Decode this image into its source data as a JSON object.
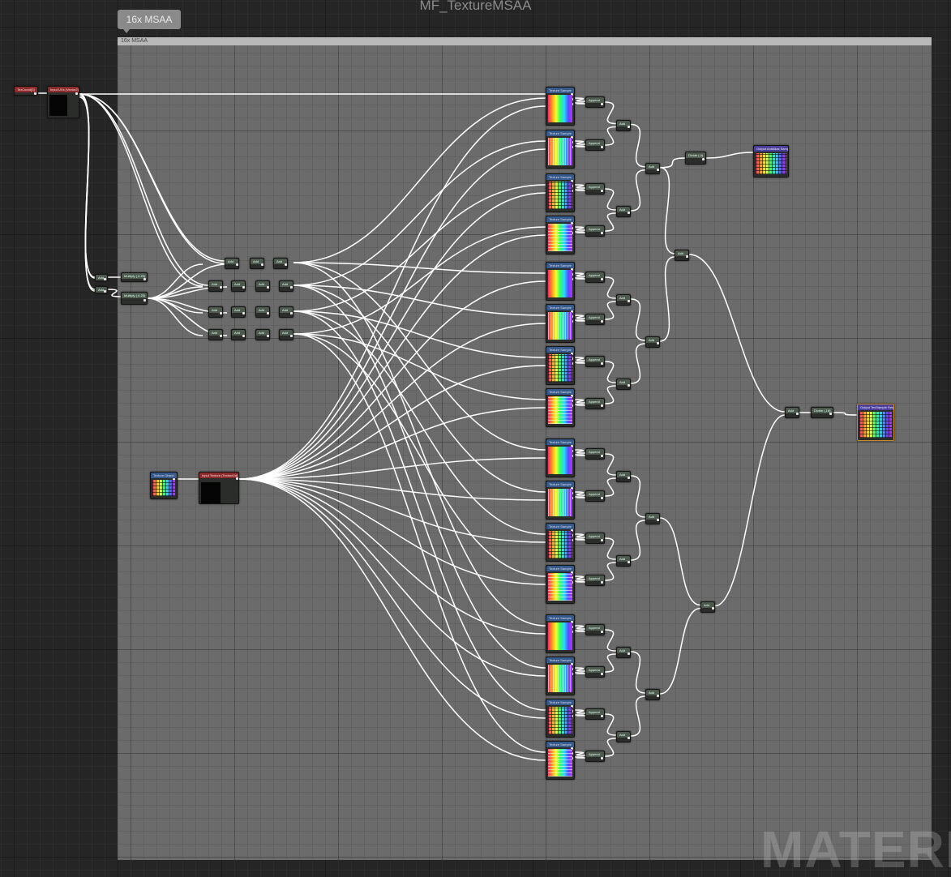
{
  "graph": {
    "title": "MF_TextureMSAA"
  },
  "comment": {
    "bubble_label": "16x MSAA",
    "header_label": "16x MSAA"
  },
  "watermark": "MATERIA",
  "nodes": {
    "texcoord_label": "TexCoord[0]",
    "input_uvs_label": "Input UVs (Vector2)",
    "texture_object_label": "Texture Object",
    "input_texture_label": "Input Texture (Texture2d)",
    "multiply_label": "Multiply (,0.25)",
    "add_label": "Add",
    "texture_sample_label": "Texture Sample",
    "append_label": "Append",
    "divide_label": "Divide (,4)",
    "divide_16_label": "Divide (,16)",
    "output_antialias_label": "Output AntiAlias Sample",
    "output_texture_label": "Output TexSample Result"
  },
  "colors": {
    "background": "#252525",
    "comment_fill": "#6b6b6b",
    "comment_header": "#b9b9b9",
    "wire": "#ffffff",
    "input_header": "#8b2b2b",
    "function_header": "#4f5a4f",
    "texture_header": "#35598a",
    "output_header": "#4b3f9a",
    "output_border": "#c98a2a"
  }
}
